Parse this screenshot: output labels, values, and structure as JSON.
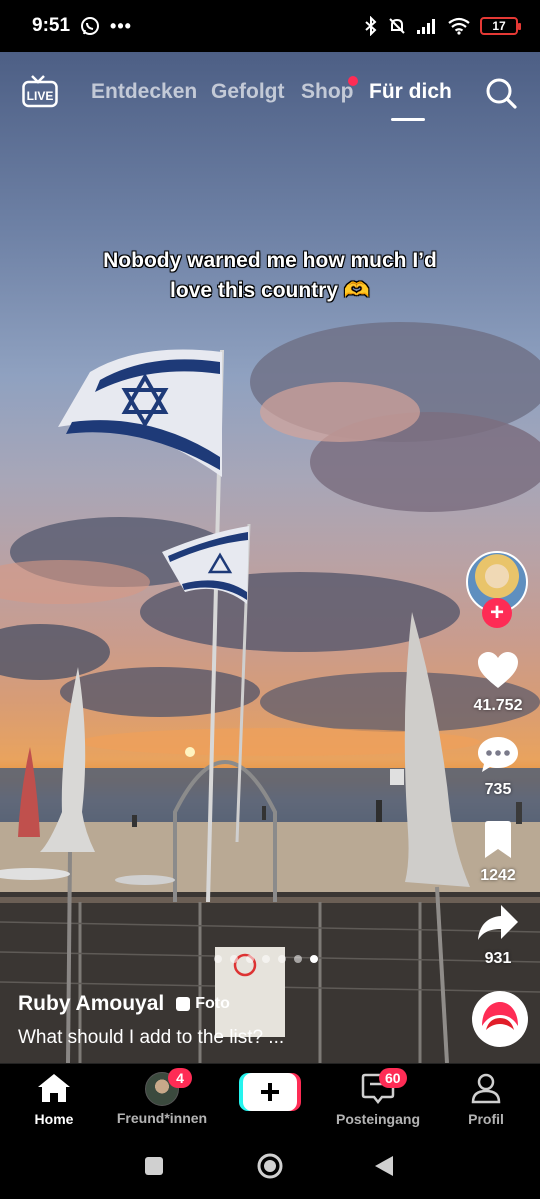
{
  "status_bar": {
    "time": "9:51",
    "whatsapp_icon": "whatsapp-icon",
    "more_icon": "ellipsis-icon",
    "battery_level": "17"
  },
  "top_nav": {
    "live_label": "LIVE",
    "tabs": [
      {
        "label": "Entdecken"
      },
      {
        "label": "Gefolgt"
      },
      {
        "label": "Shop"
      },
      {
        "label": "Für dich"
      }
    ],
    "active_tab": "Für dich"
  },
  "caption": {
    "line1": "Nobody warned me how much I’d",
    "line2": "love this country 🫶"
  },
  "actions": {
    "likes": "41.752",
    "comments": "735",
    "bookmarks": "1242",
    "shares": "931"
  },
  "carousel": {
    "total": 7,
    "active": 7
  },
  "post": {
    "author": "Ruby Amouyal",
    "type_badge": "Foto",
    "description": "What should I add to the list? ..."
  },
  "tab_bar": {
    "home": "Home",
    "friends": "Freund*innen",
    "friends_badge": "4",
    "inbox": "Posteingang",
    "inbox_badge": "60",
    "profile": "Profil"
  },
  "colors": {
    "accent": "#fe2c55",
    "cyan": "#25f4ee"
  }
}
